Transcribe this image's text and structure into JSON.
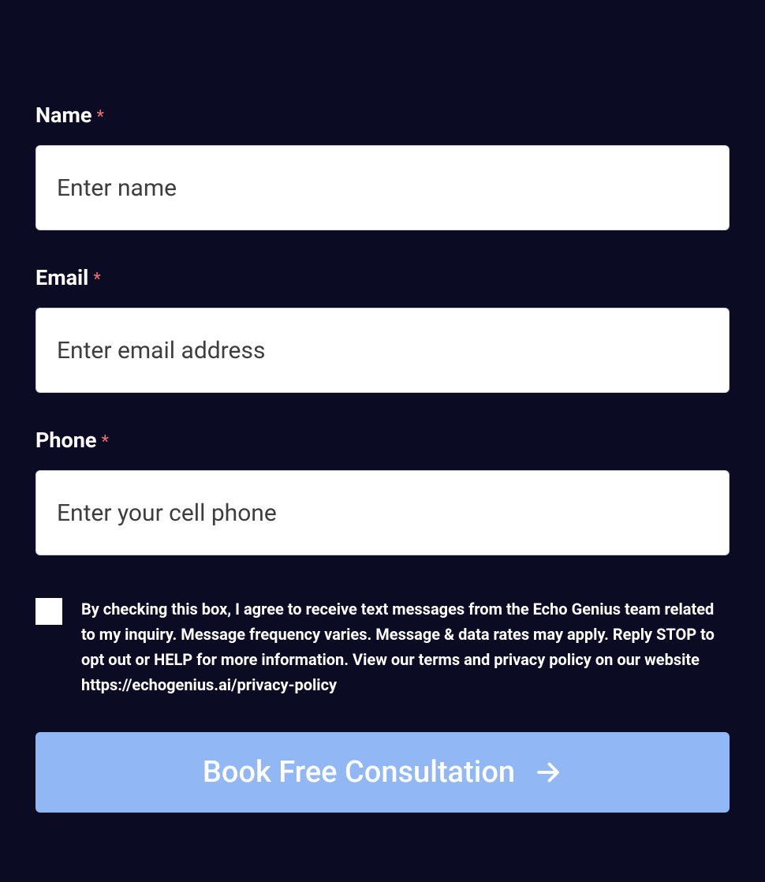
{
  "form": {
    "name": {
      "label": "Name",
      "required": "*",
      "placeholder": "Enter name"
    },
    "email": {
      "label": "Email",
      "required": "*",
      "placeholder": "Enter email address"
    },
    "phone": {
      "label": "Phone",
      "required": "*",
      "placeholder": "Enter your cell phone"
    },
    "consent": {
      "text": "By checking this box, I agree to receive text messages from the Echo Genius team related to my inquiry. Message frequency varies. Message & data rates may apply. Reply STOP to opt out or HELP for more information. View our terms and privacy policy on our website https://echogenius.ai/privacy-policy"
    },
    "submit": {
      "label": "Book Free Consultation"
    }
  }
}
